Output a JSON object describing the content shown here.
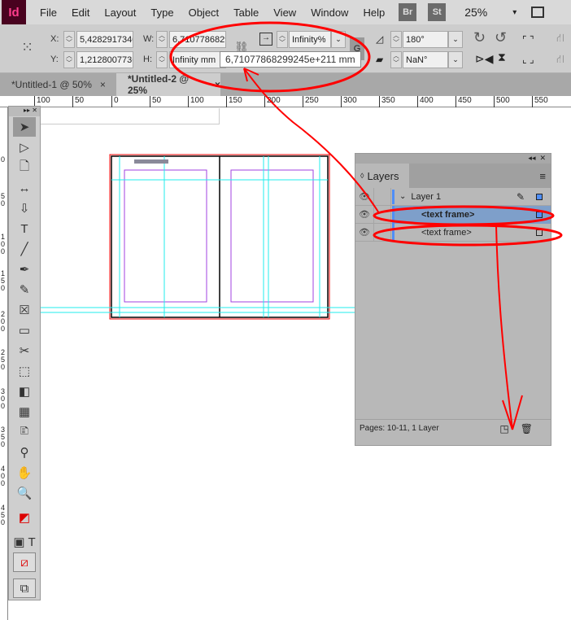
{
  "menu": {
    "logo": "Id",
    "items": [
      "File",
      "Edit",
      "Layout",
      "Type",
      "Object",
      "Table",
      "View",
      "Window",
      "Help"
    ],
    "bridge": "Br",
    "stock": "St",
    "zoom": "25%"
  },
  "control": {
    "x_label": "X:",
    "x_value": "5,42829173400",
    "y_label": "Y:",
    "y_value": "1,21280077366",
    "w_label": "W:",
    "w_value": "6,71077868299",
    "h_label": "H:",
    "h_value": "Infinity mm",
    "scale_value": "Infinity%",
    "angle_value": "180°",
    "shear_value": "NaN°",
    "tooltip": "6,71077868299245e+211 mm"
  },
  "tabs": [
    {
      "label": "*Untitled-1 @ 50%",
      "close": "×"
    },
    {
      "label": "*Untitled-2 @ 25%",
      "close": "×"
    }
  ],
  "ruler": [
    "100",
    "50",
    "0",
    "50",
    "100",
    "150",
    "200",
    "250",
    "300",
    "350",
    "400",
    "450",
    "500",
    "550"
  ],
  "vruler": [
    "0",
    "5 0",
    "1 0 0",
    "1 5 0",
    "2 0 0",
    "2 5 0",
    "3 0 0",
    "3 5 0",
    "4 0 0",
    "4 5 0"
  ],
  "layers": {
    "title": "Layers",
    "layer_name": "Layer 1",
    "items": [
      "<text frame>",
      "<text frame>"
    ],
    "footer": "Pages: 10-11, 1 Layer",
    "colors": {
      "layer": "#4f8ef7",
      "selected_row": "#7e9fca"
    }
  },
  "annotation_color": "#ff0000"
}
